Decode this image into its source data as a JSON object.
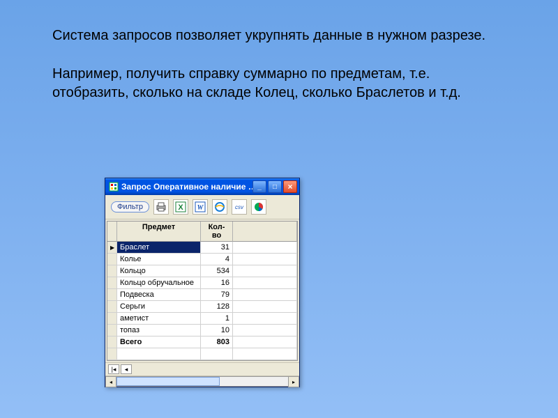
{
  "slide": {
    "para1": "Система запросов позволяет укрупнять данные в нужном разрезе.",
    "para2": "Например, получить справку суммарно по предметам, т.е. отобразить, сколько на складе Колец, сколько Браслетов и т.д."
  },
  "window": {
    "title": "Запрос Оперативное наличие …",
    "filter_label": "Фильтр"
  },
  "grid": {
    "headers": {
      "subject": "Предмет",
      "qty": "Кол-во"
    },
    "rows": [
      {
        "subject": "Браслет",
        "qty": 31,
        "selected": true
      },
      {
        "subject": "Колье",
        "qty": 4
      },
      {
        "subject": "Кольцо",
        "qty": 534
      },
      {
        "subject": "Кольцо обручальное",
        "qty": 16
      },
      {
        "subject": "Подвеска",
        "qty": 79
      },
      {
        "subject": "Серьги",
        "qty": 128
      },
      {
        "subject": "аметист",
        "qty": 1
      },
      {
        "subject": "топаз",
        "qty": 10
      }
    ],
    "total": {
      "label": "Всего",
      "qty": 803
    }
  },
  "icons": {
    "print": "print-icon",
    "excel": "excel-icon",
    "word": "word-icon",
    "ie": "ie-icon",
    "csv": "csv-icon",
    "chart": "chart-icon"
  }
}
